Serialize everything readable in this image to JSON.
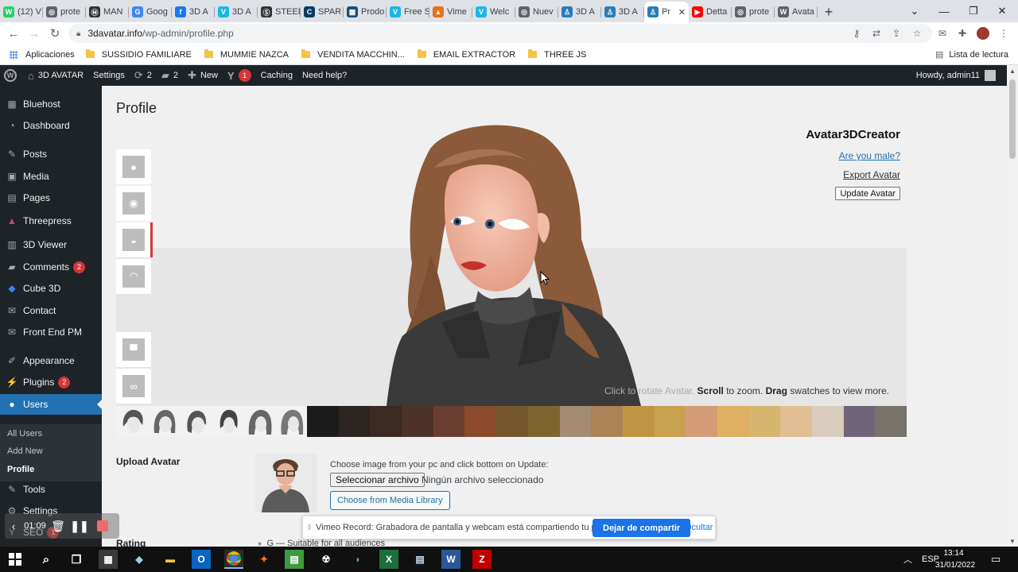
{
  "browser": {
    "tabs": [
      {
        "label": "(12) V",
        "color": "#25d366",
        "glyph": "W"
      },
      {
        "label": "prote",
        "color": "#5f6368",
        "glyph": "◎"
      },
      {
        "label": "MAN",
        "color": "#333333",
        "glyph": "Ⓜ"
      },
      {
        "label": "Goog",
        "color": "#4285f4",
        "glyph": "G"
      },
      {
        "label": "3D A",
        "color": "#1877f2",
        "glyph": "f"
      },
      {
        "label": "3D A",
        "color": "#1ab7ea",
        "glyph": "V"
      },
      {
        "label": "STEEL",
        "color": "#333333",
        "glyph": "Ⓢ"
      },
      {
        "label": "SPAR",
        "color": "#0a3d62",
        "glyph": "C"
      },
      {
        "label": "Prodo",
        "color": "#1f4e79",
        "glyph": "▦"
      },
      {
        "label": "Free S",
        "color": "#1ab7ea",
        "glyph": "V"
      },
      {
        "label": "Vime",
        "color": "#e8711a",
        "glyph": "▲"
      },
      {
        "label": "Welc",
        "color": "#1ab7ea",
        "glyph": "V"
      },
      {
        "label": "Nuev",
        "color": "#5f6368",
        "glyph": "◎"
      },
      {
        "label": "3D A",
        "color": "#2b7bb9",
        "glyph": "♙"
      },
      {
        "label": "3D A",
        "color": "#2b7bb9",
        "glyph": "♙"
      },
      {
        "label": "Pr",
        "color": "#2b7bb9",
        "glyph": "♙",
        "active": true
      },
      {
        "label": "Detta",
        "color": "#ff0000",
        "glyph": "▶"
      },
      {
        "label": "prote",
        "color": "#5f6368",
        "glyph": "◎"
      },
      {
        "label": "Avata",
        "color": "#5f6368",
        "glyph": "W"
      }
    ],
    "url_host": "3davatar.info",
    "url_path": "/wp-admin/profile.php",
    "bookmarks": {
      "apps": "Aplicaciones",
      "items": [
        "SUSSIDIO FAMILIARE",
        "MUMMIE NAZCA",
        "VENDITA MACCHIN...",
        "EMAIL EXTRACTOR",
        "THREE JS"
      ],
      "reading_list": "Lista de lectura"
    }
  },
  "adminbar": {
    "site": "3D AVATAR",
    "settings": "Settings",
    "updates": "2",
    "comments": "2",
    "new": "New",
    "yoast_count": "1",
    "caching": "Caching",
    "help": "Need help?",
    "howdy": "Howdy, admin11"
  },
  "sidebar": {
    "items": [
      {
        "label": "Bluehost",
        "icon": "grid-icon",
        "glyph": "▦"
      },
      {
        "label": "Dashboard",
        "icon": "dashboard-icon",
        "glyph": "◔"
      },
      {
        "label": "Posts",
        "icon": "pin-icon",
        "glyph": "✎"
      },
      {
        "label": "Media",
        "icon": "media-icon",
        "glyph": "▣"
      },
      {
        "label": "Pages",
        "icon": "pages-icon",
        "glyph": "▤"
      },
      {
        "label": "Threepress",
        "icon": "triangle-icon",
        "glyph": "▲"
      },
      {
        "label": "3D Viewer",
        "icon": "viewer-icon",
        "glyph": "▥"
      },
      {
        "label": "Comments",
        "icon": "comment-icon",
        "glyph": "▰",
        "badge": "2"
      },
      {
        "label": "Cube 3D",
        "icon": "cube-icon",
        "glyph": "◆"
      },
      {
        "label": "Contact",
        "icon": "mail-icon",
        "glyph": "✉"
      },
      {
        "label": "Front End PM",
        "icon": "mail-icon",
        "glyph": "✉"
      },
      {
        "label": "Appearance",
        "icon": "brush-icon",
        "glyph": "✐"
      },
      {
        "label": "Plugins",
        "icon": "plugin-icon",
        "glyph": "⚡",
        "badge": "2"
      },
      {
        "label": "Users",
        "icon": "user-icon",
        "glyph": "●",
        "current": true
      },
      {
        "label": "Tools",
        "icon": "wrench-icon",
        "glyph": "✎"
      },
      {
        "label": "Settings",
        "icon": "settings-icon",
        "glyph": "⚙"
      },
      {
        "label": "SEO",
        "icon": "yoast-icon",
        "glyph": "Y",
        "badge": "1"
      }
    ],
    "submenu": [
      "All Users",
      "Add New",
      "Profile"
    ]
  },
  "page": {
    "title": "Profile",
    "creator": {
      "title": "Avatar3DCreator",
      "gender_link": "Are you male?",
      "export": "Export Avatar",
      "update": "Update Avatar",
      "hint_faded": "Click to rotate Avatar.",
      "hint_scroll": "Scroll",
      "hint_zoom": "to zoom.",
      "hint_drag": "Drag",
      "hint_swatches": "swatches to view more."
    },
    "tool_icons": [
      "face-icon",
      "eye-icon",
      "hair-icon",
      "eyebrow-icon",
      "shirt-icon",
      "glasses-icon"
    ],
    "skin_swatches": [
      "#1b1b1b",
      "#2b2421",
      "#3a2a22",
      "#4d3325",
      "#6a3e2e",
      "#8a4a2b",
      "#75572e",
      "#7d6530",
      "#a58b74",
      "#ab8356",
      "#bf9544",
      "#c8a14f",
      "#d59c78",
      "#e0b062",
      "#d7b66f",
      "#e2bf94",
      "#d8ccba",
      "#6f6478",
      "#77726a"
    ],
    "upload": {
      "label": "Upload Avatar",
      "instruction": "Choose image from your pc and click bottom on Update:",
      "file_button": "Seleccionar archivo",
      "file_status": "Ningún archivo seleccionado",
      "media_button": "Choose from Media Library"
    },
    "rating": {
      "label": "Rating",
      "option": "G — Suitable for all audiences"
    }
  },
  "share_bar": {
    "message": "Vimeo Record: Grabadora de pantalla y webcam está compartiendo tu pantalla.",
    "stop": "Dejar de compartir",
    "hide": "Ocultar"
  },
  "recorder": {
    "time": "01:09"
  },
  "taskbar": {
    "language": "ESP",
    "time": "13:14",
    "date": "31/01/2022"
  }
}
